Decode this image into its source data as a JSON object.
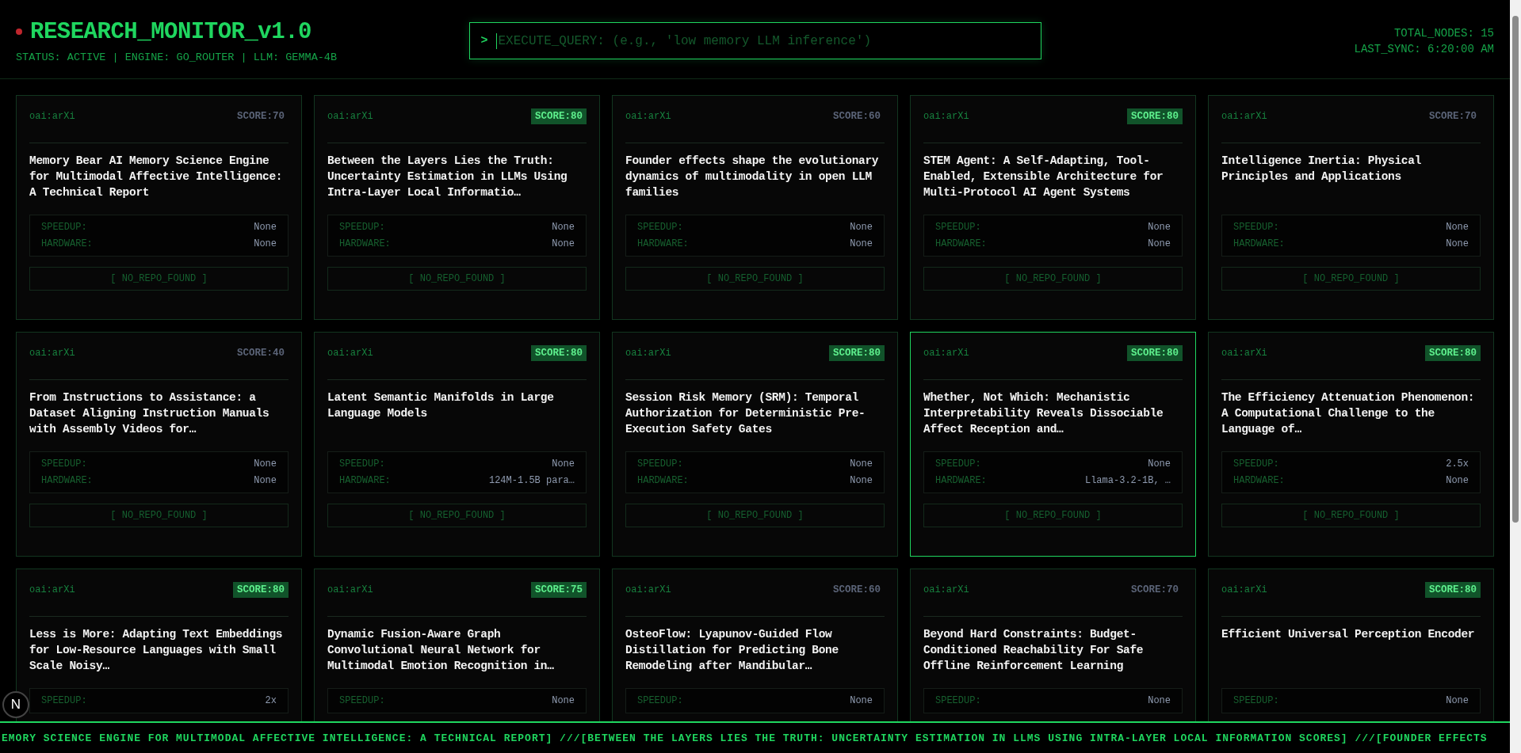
{
  "header": {
    "title": "RESEARCH_MONITOR_v1.0",
    "status_line": "STATUS: ACTIVE | ENGINE: GO_ROUTER | LLM: GEMMA-4B",
    "live": true,
    "query": {
      "prompt": ">",
      "placeholder": "EXECUTE_QUERY: (e.g., 'low memory LLM inference')"
    },
    "total_nodes": "TOTAL_NODES: 15",
    "last_sync": "LAST_SYNC: 6:20:00 AM"
  },
  "papers": [
    {
      "source": "oai:arXi",
      "score": "SCORE:70",
      "high": false,
      "selected": false,
      "title": "Memory Bear AI Memory Science Engine for Multimodal Affective Intelligence: A Technical Report",
      "stats": [
        {
          "label": "SPEEDUP:",
          "value": "None"
        },
        {
          "label": "HARDWARE:",
          "value": "None"
        }
      ],
      "repo": "[ NO_REPO_FOUND ]"
    },
    {
      "source": "oai:arXi",
      "score": "SCORE:80",
      "high": true,
      "selected": false,
      "title": "Between the Layers Lies the Truth: Uncertainty Estimation in LLMs Using Intra-Layer Local Informatio…",
      "stats": [
        {
          "label": "SPEEDUP:",
          "value": "None"
        },
        {
          "label": "HARDWARE:",
          "value": "None"
        }
      ],
      "repo": "[ NO_REPO_FOUND ]"
    },
    {
      "source": "oai:arXi",
      "score": "SCORE:60",
      "high": false,
      "selected": false,
      "title": "Founder effects shape the evolutionary dynamics of multimodality in open LLM families",
      "stats": [
        {
          "label": "SPEEDUP:",
          "value": "None"
        },
        {
          "label": "HARDWARE:",
          "value": "None"
        }
      ],
      "repo": "[ NO_REPO_FOUND ]"
    },
    {
      "source": "oai:arXi",
      "score": "SCORE:80",
      "high": true,
      "selected": false,
      "title": "STEM Agent: A Self-Adapting, Tool-Enabled, Extensible Architecture for Multi-Protocol AI Agent Systems",
      "stats": [
        {
          "label": "SPEEDUP:",
          "value": "None"
        },
        {
          "label": "HARDWARE:",
          "value": "None"
        }
      ],
      "repo": "[ NO_REPO_FOUND ]"
    },
    {
      "source": "oai:arXi",
      "score": "SCORE:70",
      "high": false,
      "selected": false,
      "title": "Intelligence Inertia: Physical Principles and Applications",
      "stats": [
        {
          "label": "SPEEDUP:",
          "value": "None"
        },
        {
          "label": "HARDWARE:",
          "value": "None"
        }
      ],
      "repo": "[ NO_REPO_FOUND ]"
    },
    {
      "source": "oai:arXi",
      "score": "SCORE:40",
      "high": false,
      "selected": false,
      "title": "From Instructions to Assistance: a Dataset Aligning Instruction Manuals with Assembly Videos for…",
      "stats": [
        {
          "label": "SPEEDUP:",
          "value": "None"
        },
        {
          "label": "HARDWARE:",
          "value": "None"
        }
      ],
      "repo": "[ NO_REPO_FOUND ]"
    },
    {
      "source": "oai:arXi",
      "score": "SCORE:80",
      "high": true,
      "selected": false,
      "title": "Latent Semantic Manifolds in Large Language Models",
      "stats": [
        {
          "label": "SPEEDUP:",
          "value": "None"
        },
        {
          "label": "HARDWARE:",
          "value": "124M-1.5B para…"
        }
      ],
      "repo": "[ NO_REPO_FOUND ]"
    },
    {
      "source": "oai:arXi",
      "score": "SCORE:80",
      "high": true,
      "selected": false,
      "title": "Session Risk Memory (SRM): Temporal Authorization for Deterministic Pre-Execution Safety Gates",
      "stats": [
        {
          "label": "SPEEDUP:",
          "value": "None"
        },
        {
          "label": "HARDWARE:",
          "value": "None"
        }
      ],
      "repo": "[ NO_REPO_FOUND ]"
    },
    {
      "source": "oai:arXi",
      "score": "SCORE:80",
      "high": true,
      "selected": true,
      "title": "Whether, Not Which: Mechanistic Interpretability Reveals Dissociable Affect Reception and…",
      "stats": [
        {
          "label": "SPEEDUP:",
          "value": "None"
        },
        {
          "label": "HARDWARE:",
          "value": "Llama-3.2-1B, …"
        }
      ],
      "repo": "[ NO_REPO_FOUND ]"
    },
    {
      "source": "oai:arXi",
      "score": "SCORE:80",
      "high": true,
      "selected": false,
      "title": "The Efficiency Attenuation Phenomenon: A Computational Challenge to the Language of…",
      "stats": [
        {
          "label": "SPEEDUP:",
          "value": "2.5x"
        },
        {
          "label": "HARDWARE:",
          "value": "None"
        }
      ],
      "repo": "[ NO_REPO_FOUND ]"
    },
    {
      "source": "oai:arXi",
      "score": "SCORE:80",
      "high": true,
      "selected": false,
      "title": "Less is More: Adapting Text Embeddings for Low-Resource Languages with Small Scale Noisy…",
      "stats": [
        {
          "label": "SPEEDUP:",
          "value": "2x"
        }
      ]
    },
    {
      "source": "oai:arXi",
      "score": "SCORE:75",
      "high": true,
      "selected": false,
      "title": "Dynamic Fusion-Aware Graph Convolutional Neural Network for Multimodal Emotion Recognition in…",
      "stats": [
        {
          "label": "SPEEDUP:",
          "value": "None"
        }
      ]
    },
    {
      "source": "oai:arXi",
      "score": "SCORE:60",
      "high": false,
      "selected": false,
      "title": "OsteoFlow: Lyapunov-Guided Flow Distillation for Predicting Bone Remodeling after Mandibular…",
      "stats": [
        {
          "label": "SPEEDUP:",
          "value": "None"
        }
      ]
    },
    {
      "source": "oai:arXi",
      "score": "SCORE:70",
      "high": false,
      "selected": false,
      "title": "Beyond Hard Constraints: Budget-Conditioned Reachability For Safe Offline Reinforcement Learning",
      "stats": [
        {
          "label": "SPEEDUP:",
          "value": "None"
        }
      ]
    },
    {
      "source": "oai:arXi",
      "score": "SCORE:80",
      "high": true,
      "selected": false,
      "title": "Efficient Universal Perception Encoder",
      "stats": [
        {
          "label": "SPEEDUP:",
          "value": "None"
        }
      ]
    }
  ],
  "ticker": "EMORY SCIENCE ENGINE FOR MULTIMODAL AFFECTIVE INTELLIGENCE: A TECHNICAL REPORT] ///[BETWEEN THE LAYERS LIES THE TRUTH: UNCERTAINTY ESTIMATION IN LLMS USING INTRA-LAYER LOCAL INFORMATION SCORES] ///[FOUNDER EFFECTS",
  "dev_badge": "N"
}
